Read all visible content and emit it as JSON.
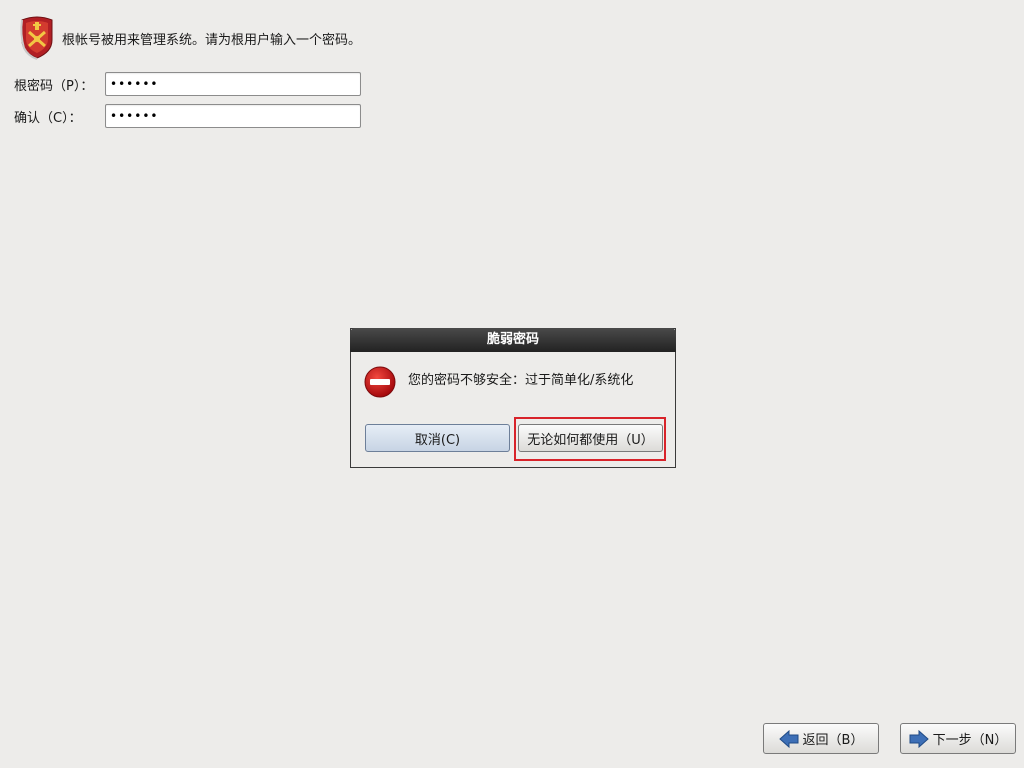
{
  "header": {
    "logo_icon": "shield-crest-icon",
    "intro_text": "根帐号被用来管理系统。请为根用户输入一个密码。"
  },
  "form": {
    "root_password": {
      "label": "根密码（P）：",
      "value": "••••••"
    },
    "confirm_password": {
      "label": "确认（C）：",
      "value": "••••••"
    }
  },
  "dialog": {
    "title": "脆弱密码",
    "icon": "error-icon",
    "message": "您的密码不够安全：过于简单化/系统化",
    "cancel_label": "取消(C)",
    "use_anyway_label": "无论如何都使用（U）",
    "highlight_color": "#d8232a"
  },
  "nav": {
    "back_label": "返回（B）",
    "next_label": "下一步（N）",
    "back_icon": "arrow-left-icon",
    "next_icon": "arrow-right-icon",
    "arrow_color": "#3d6fb6"
  }
}
